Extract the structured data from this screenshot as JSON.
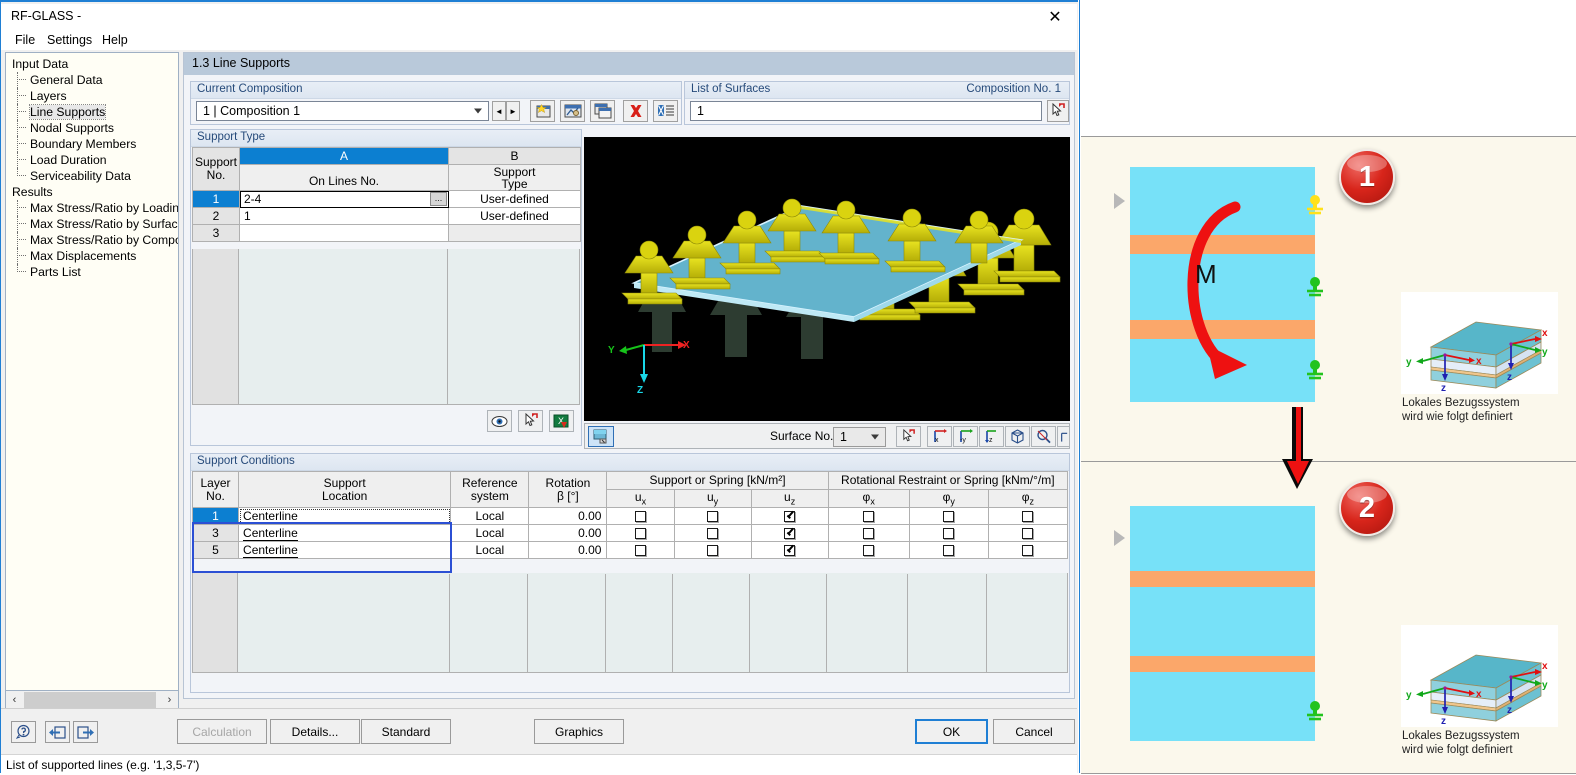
{
  "window": {
    "title": "RF-GLASS -",
    "close_label": "✕",
    "menus": [
      "File",
      "Settings",
      "Help"
    ]
  },
  "tree": {
    "groups": [
      {
        "label": "Input Data",
        "items": [
          "General Data",
          "Layers",
          "Line Supports",
          "Nodal Supports",
          "Boundary Members",
          "Load Duration",
          "Serviceability Data"
        ],
        "selected": "Line Supports"
      },
      {
        "label": "Results",
        "items": [
          "Max Stress/Ratio by Loading",
          "Max Stress/Ratio by Surface",
          "Max Stress/Ratio by Compositio",
          "Max Displacements",
          "Parts List"
        ],
        "selected": ""
      }
    ]
  },
  "page": {
    "header": "1.3 Line Supports"
  },
  "current_composition": {
    "title": "Current Composition",
    "value": "1 | Composition 1",
    "nav_prev": "◄",
    "nav_next": "►",
    "buttons": [
      "new-composition-icon",
      "edit-composition-icon",
      "copy-composition-icon",
      "delete-composition-icon",
      "composition-list-icon"
    ]
  },
  "list_of_surfaces": {
    "title": "List of Surfaces",
    "right_title": "Composition No. 1",
    "value": "1",
    "pick_button": "pick-surface-icon"
  },
  "support_type": {
    "title": "Support Type",
    "col_letters": [
      "",
      "A",
      "B"
    ],
    "headers": [
      "Support\nNo.",
      "On Lines No.",
      "Support\nType"
    ],
    "header_line1": [
      "Support",
      "",
      "Support"
    ],
    "header_line2": [
      "No.",
      "On Lines No.",
      "Type"
    ],
    "rows": [
      {
        "no": "1",
        "lines": "2-4",
        "type": "User-defined",
        "selected": true
      },
      {
        "no": "2",
        "lines": "1",
        "type": "User-defined",
        "selected": false
      },
      {
        "no": "3",
        "lines": "",
        "type": "",
        "selected": false
      }
    ],
    "ellipsis_button": "..."
  },
  "support_type_toolbar": {
    "buttons": [
      "view-icon",
      "pick-icon",
      "export-excel-icon"
    ]
  },
  "viewport": {
    "axis_x": "X",
    "axis_y": "Y",
    "axis_z": "Z"
  },
  "viewport_toolbar": {
    "render_mode_button": "render-mode-icon",
    "surface_label": "Surface No.:",
    "surface_value": "1",
    "buttons": [
      "pick-surface-icon",
      "view-in-x-icon",
      "view-in-minus-y-icon",
      "view-in-z-icon",
      "isometric-view-icon",
      "zoom-all-icon",
      "show-axes-icon"
    ]
  },
  "support_conditions": {
    "title": "Support Conditions",
    "group_headers": [
      {
        "label": "Support or Spring [kN/m²]",
        "span": 3
      },
      {
        "label": "Rotational Restraint or Spring [kNm/°/m]",
        "span": 3
      }
    ],
    "headers_line1": [
      "Layer",
      "Support",
      "Reference",
      "Rotation"
    ],
    "headers_line2": [
      "No.",
      "Location",
      "system",
      "β [°]"
    ],
    "sub_headers": [
      "uₓ",
      "uᵧ",
      "uᶻ",
      "φₓ",
      "φᵧ",
      "φᶻ"
    ],
    "sub_headers_base": [
      "u",
      "u",
      "u",
      "φ",
      "φ",
      "φ"
    ],
    "sub_headers_sub": [
      "x",
      "y",
      "z",
      "x",
      "y",
      "z"
    ],
    "rows": [
      {
        "layer": "1",
        "location": "Centerline",
        "reference": "Local",
        "rotation": "0.00",
        "checks": [
          false,
          false,
          true,
          false,
          false,
          false
        ],
        "selected": true
      },
      {
        "layer": "3",
        "location": "Centerline",
        "reference": "Local",
        "rotation": "0.00",
        "checks": [
          false,
          false,
          true,
          false,
          false,
          false
        ],
        "selected": false
      },
      {
        "layer": "5",
        "location": "Centerline",
        "reference": "Local",
        "rotation": "0.00",
        "checks": [
          false,
          false,
          true,
          false,
          false,
          false
        ],
        "selected": false
      }
    ]
  },
  "bottom_bar": {
    "icon_buttons": [
      "help-icon",
      "previous-module-icon",
      "next-module-icon"
    ],
    "calculation": "Calculation",
    "details": "Details...",
    "standard": "Standard",
    "graphics": "Graphics",
    "ok": "OK",
    "cancel": "Cancel"
  },
  "statusbar": {
    "text": "List of supported lines (e.g. '1,3,5-7')"
  },
  "figures": [
    {
      "badge": "1",
      "moment_label": "M",
      "caption_line1": "Lokales Bezugssystem",
      "caption_line2": "wird wie folgt definiert",
      "axis_labels": {
        "x": "x",
        "y": "y",
        "z": "z"
      },
      "supports": [
        {
          "color": "#ffe11a",
          "name": "support-symbol-yellow"
        },
        {
          "color": "#22c31e",
          "name": "support-symbol-green"
        },
        {
          "color": "#22c31e",
          "name": "support-symbol-green"
        }
      ]
    },
    {
      "badge": "2",
      "moment_label": "",
      "caption_line1": "Lokales Bezugssystem",
      "caption_line2": "wird wie folgt definiert",
      "axis_labels": {
        "x": "x",
        "y": "y",
        "z": "z"
      },
      "supports": [
        {
          "color": "#22c31e",
          "name": "support-symbol-green"
        }
      ]
    }
  ],
  "colors": {
    "accent_blue": "#1f7fd4",
    "header_blue": "#0c7fd1",
    "glass": "#77e1f8",
    "interlayer": "#fba76a",
    "support_yellow": "#ffe11a",
    "support_green": "#22c31e",
    "arrow_red": "#ee1111",
    "panel_cream": "#fbf8ec"
  }
}
